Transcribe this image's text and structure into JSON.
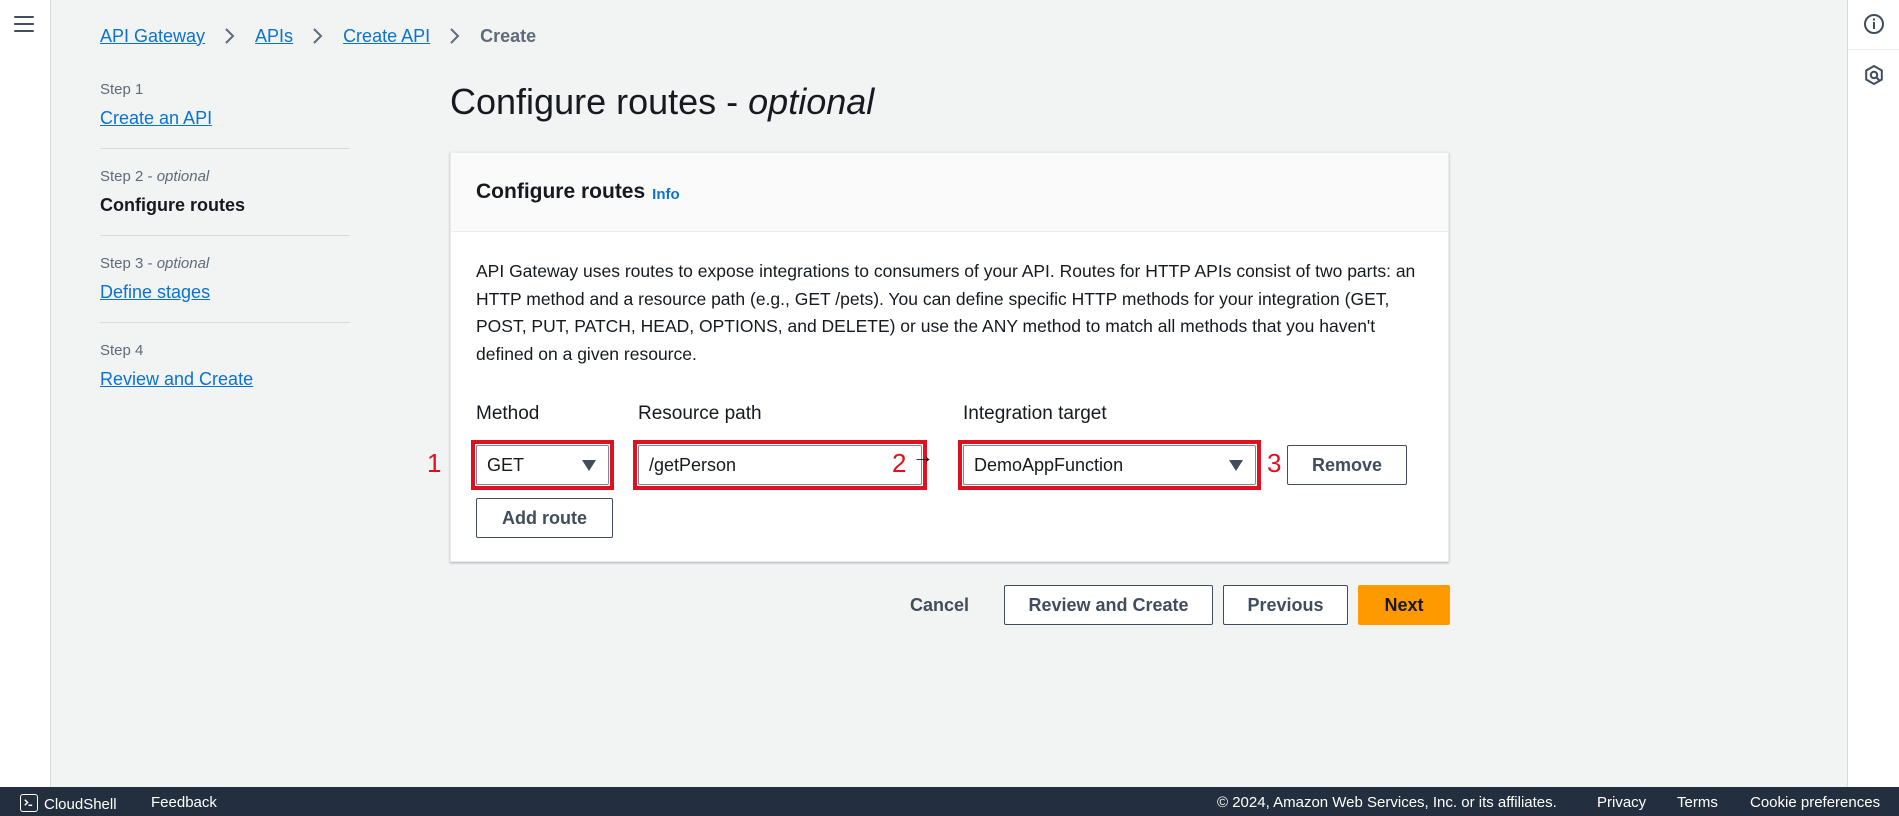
{
  "breadcrumb": {
    "items": [
      "API Gateway",
      "APIs",
      "Create API"
    ],
    "current": "Create"
  },
  "steps": [
    {
      "num": "Step 1",
      "optional": "",
      "title": "Create an API"
    },
    {
      "num": "Step 2",
      "optional": "optional",
      "title": "Configure routes"
    },
    {
      "num": "Step 3",
      "optional": "optional",
      "title": "Define stages"
    },
    {
      "num": "Step 4",
      "optional": "",
      "title": "Review and Create"
    }
  ],
  "page": {
    "title": "Configure routes - ",
    "title_italic": "optional"
  },
  "container": {
    "title": "Configure routes",
    "info": "Info",
    "description": "API Gateway uses routes to expose integrations to consumers of your API. Routes for HTTP APIs consist of two parts: an HTTP method and a resource path (e.g., GET /pets). You can define specific HTTP methods for your integration (GET, POST, PUT, PATCH, HEAD, OPTIONS, and DELETE) or use the ANY method to match all methods that you haven't defined on a given resource."
  },
  "route": {
    "method_label": "Method",
    "method_value": "GET",
    "path_label": "Resource path",
    "path_value": "/getPerson",
    "target_label": "Integration target",
    "target_value": "DemoAppFunction",
    "remove_label": "Remove",
    "add_label": "Add route",
    "arrow": "→"
  },
  "annotations": [
    "1",
    "2",
    "3"
  ],
  "actions": {
    "cancel": "Cancel",
    "review": "Review and Create",
    "previous": "Previous",
    "next": "Next"
  },
  "footer": {
    "cloudshell": "CloudShell",
    "feedback": "Feedback",
    "copyright": "© 2024, Amazon Web Services, Inc. or its affiliates.",
    "privacy": "Privacy",
    "terms": "Terms",
    "cookies": "Cookie preferences"
  },
  "colors": {
    "primary_button": "#ff9900",
    "link": "#0972d3",
    "highlight": "#e0101e",
    "footer_bg": "#232f3e"
  },
  "icons": [
    "menu-icon",
    "info-icon",
    "gear-icon",
    "chevron-right-icon",
    "caret-down-icon",
    "cloudshell-icon"
  ]
}
